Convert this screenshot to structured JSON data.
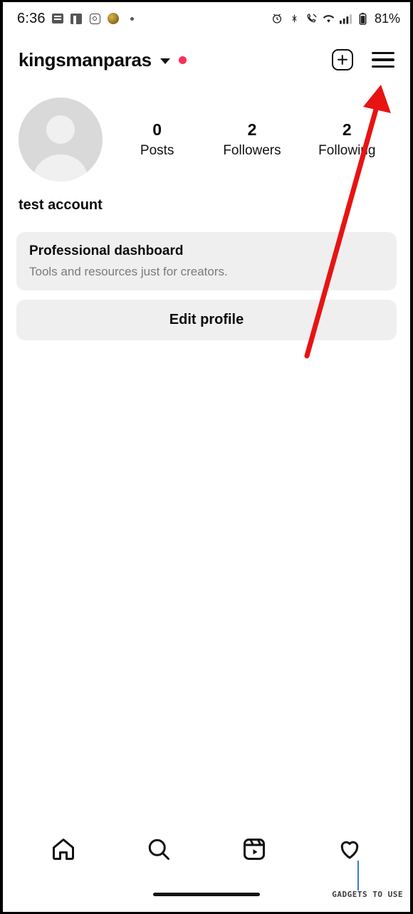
{
  "status_bar": {
    "time": "6:36",
    "icons_left": [
      "messages-icon",
      "facebook-icon",
      "instagram-icon",
      "gold-coin-icon",
      "small-dot-icon"
    ],
    "icons_right": [
      "alarm-icon",
      "bluetooth-icon",
      "call-mute-icon",
      "wifi-icon",
      "cellular-signal-icon",
      "battery-icon"
    ],
    "battery_percent": "81%"
  },
  "header": {
    "username": "kingsmanparas",
    "dropdown_icon": "chevron-down-icon",
    "activity_dot": "new-activity-dot",
    "add_label": "new-post-icon",
    "menu_label": "hamburger-menu-icon"
  },
  "profile": {
    "avatar": "profile-avatar",
    "full_name": "test account",
    "stats": [
      {
        "value": "0",
        "label": "Posts"
      },
      {
        "value": "2",
        "label": "Followers"
      },
      {
        "value": "2",
        "label": "Following"
      }
    ]
  },
  "cards": {
    "dashboard_title": "Professional dashboard",
    "dashboard_sub": "Tools and resources just for creators.",
    "edit_profile": "Edit profile"
  },
  "annotation": {
    "type": "arrow",
    "color": "#e81313",
    "points_to": "hamburger-menu-icon"
  },
  "bottom_nav": [
    {
      "name": "home-icon",
      "label": "Home"
    },
    {
      "name": "search-icon",
      "label": "Search"
    },
    {
      "name": "reels-icon",
      "label": "Reels"
    },
    {
      "name": "heart-icon",
      "label": "Activity"
    }
  ],
  "watermark": "GADGETS TO USE",
  "colors": {
    "accent": "#e81313",
    "card_bg": "#efefef",
    "text": "#0b0b0b",
    "muted": "#7a7a7a"
  }
}
